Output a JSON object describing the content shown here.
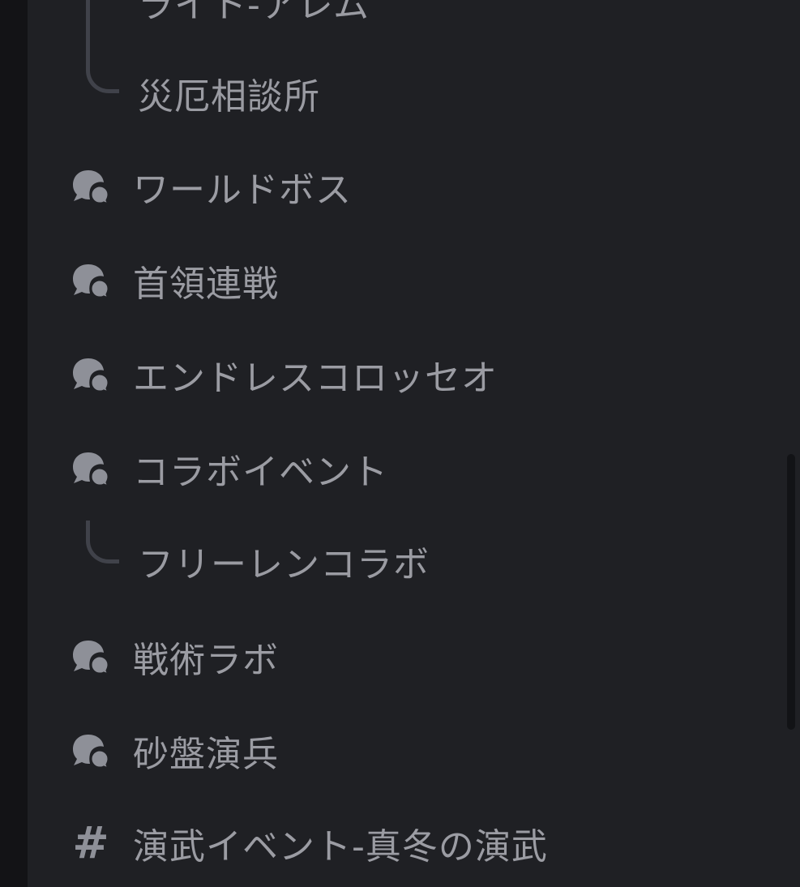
{
  "channels": [
    {
      "type": "thread",
      "label": "ライト-アレム",
      "icon": "none"
    },
    {
      "type": "thread",
      "label": "災厄相談所",
      "icon": "none"
    },
    {
      "type": "forum",
      "label": "ワールドボス",
      "icon": "forum-icon"
    },
    {
      "type": "forum",
      "label": "首領連戦",
      "icon": "forum-icon"
    },
    {
      "type": "forum",
      "label": "エンドレスコロッセオ",
      "icon": "forum-icon"
    },
    {
      "type": "forum",
      "label": "コラボイベント",
      "icon": "forum-icon"
    },
    {
      "type": "thread",
      "label": "フリーレンコラボ",
      "icon": "none"
    },
    {
      "type": "forum",
      "label": "戦術ラボ",
      "icon": "forum-icon"
    },
    {
      "type": "forum",
      "label": "砂盤演兵",
      "icon": "forum-icon"
    },
    {
      "type": "text",
      "label": "演武イベント-真冬の演武",
      "icon": "hash-icon"
    }
  ],
  "colors": {
    "background": "#1f2024",
    "text": "#9b9ca3",
    "icon": "#8e9098",
    "thread_line": "#40424a"
  }
}
